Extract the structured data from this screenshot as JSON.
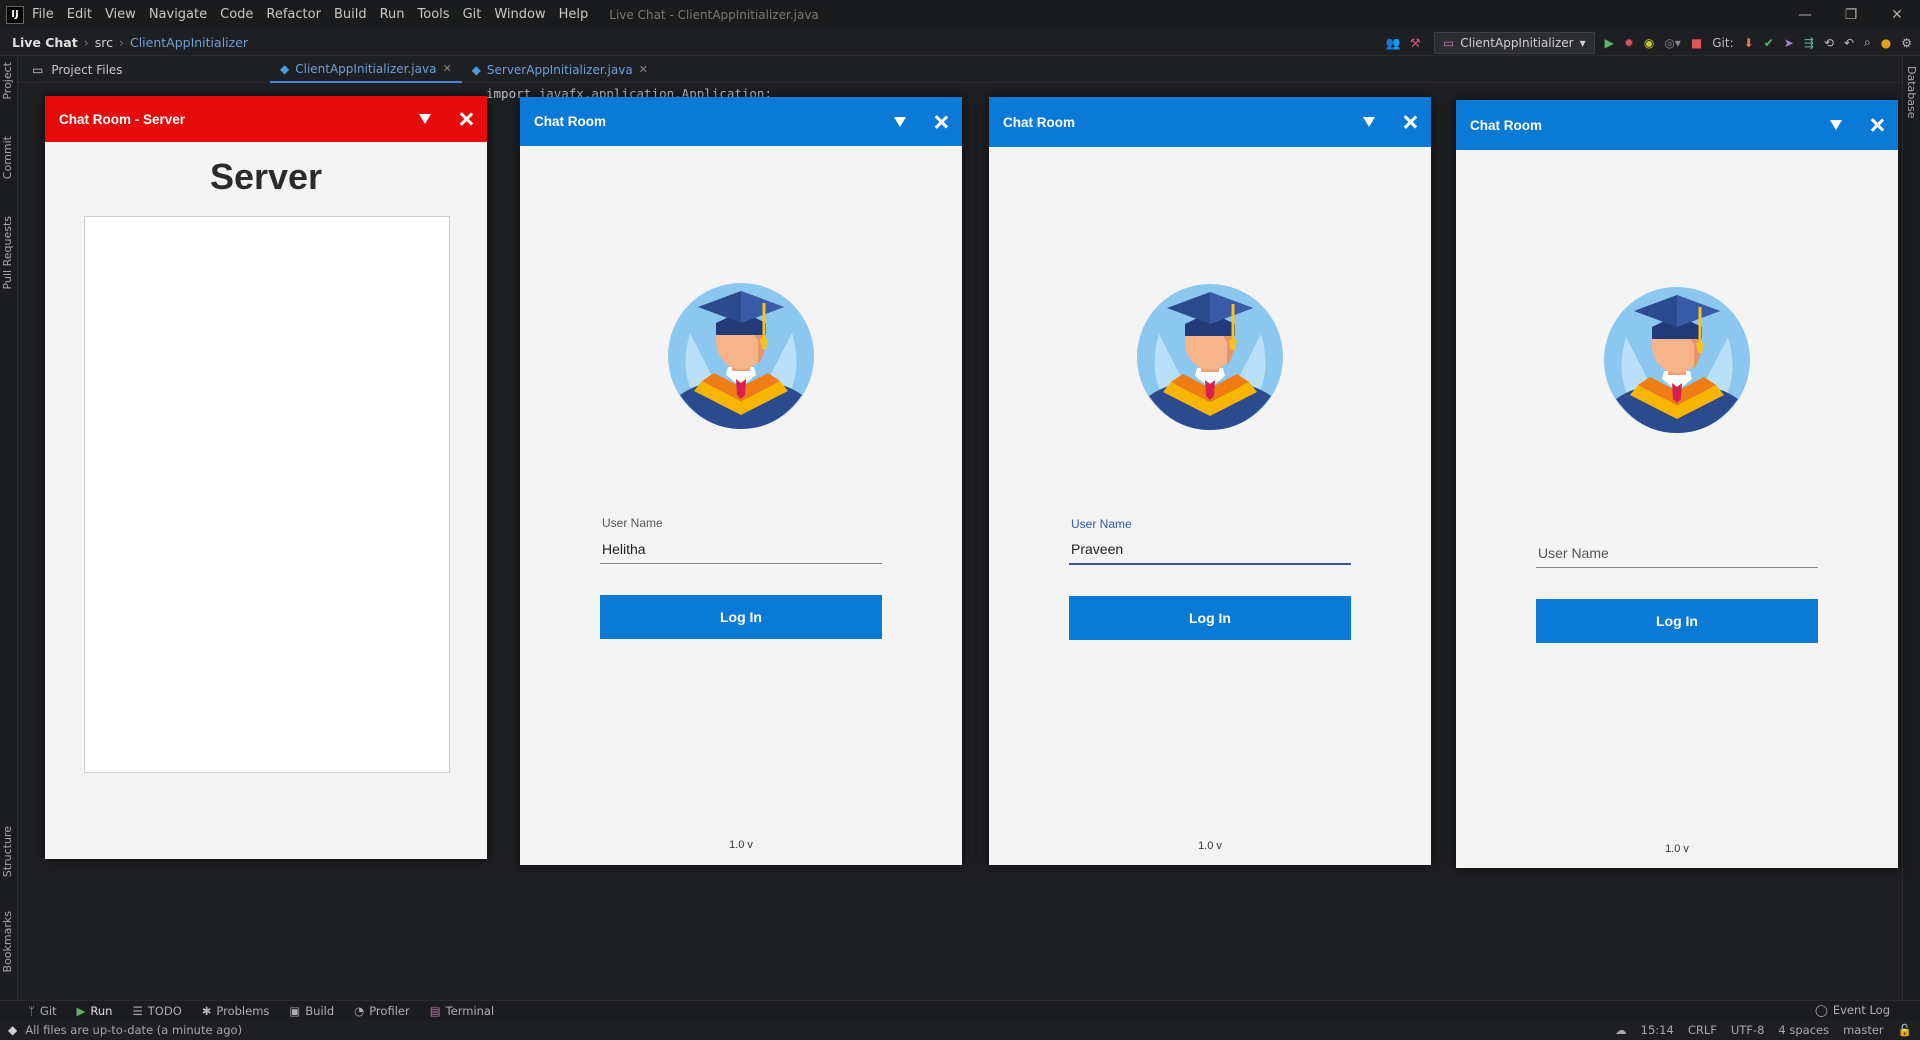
{
  "ide": {
    "logo": "IJ",
    "menu": [
      "File",
      "Edit",
      "View",
      "Navigate",
      "Code",
      "Refactor",
      "Build",
      "Run",
      "Tools",
      "Git",
      "Window",
      "Help"
    ],
    "window_title": "Live Chat - ClientAppInitializer.java",
    "breadcrumb": [
      "Live Chat",
      "src",
      "ClientAppInitializer"
    ],
    "run_config": "ClientAppInitializer",
    "git_label": "Git:",
    "project_label": "Project Files",
    "tabs": [
      {
        "label": "ClientAppInitializer.java",
        "active": true
      },
      {
        "label": "ServerAppInitializer.java",
        "active": false
      }
    ],
    "code_first_line": "import javafx.application.Application;",
    "side_tabs": [
      "Project",
      "Commit",
      "Pull Requests",
      "Structure",
      "Bookmarks"
    ],
    "right_tab": "Database",
    "bottom_tabs": [
      "Git",
      "Run",
      "TODO",
      "Problems",
      "Build",
      "Profiler",
      "Terminal"
    ],
    "event_log": "Event Log",
    "status_message": "All files are up-to-date (a minute ago)",
    "status_right": [
      "15:14",
      "CRLF",
      "UTF-8",
      "4 spaces",
      "master"
    ],
    "colors": {
      "menubar": "#1a1b1d",
      "editor_bg": "#1e1f22"
    }
  },
  "server_window": {
    "title": "Chat Room - Server",
    "heading": "Server",
    "title_color": "#e60a0a"
  },
  "client_windows": [
    {
      "title": "Chat Room",
      "label": "User Name",
      "value": "Helitha",
      "placeholder": "",
      "button": "Log In",
      "version": "1.0 v"
    },
    {
      "title": "Chat Room",
      "label": "User Name",
      "value": "Praveen",
      "placeholder": "",
      "button": "Log In",
      "version": "1.0 v"
    },
    {
      "title": "Chat Room",
      "label": "",
      "value": "",
      "placeholder": "User Name",
      "button": "Log In",
      "version": "1.0 v"
    }
  ],
  "client_title_color": "#0b7ad7"
}
